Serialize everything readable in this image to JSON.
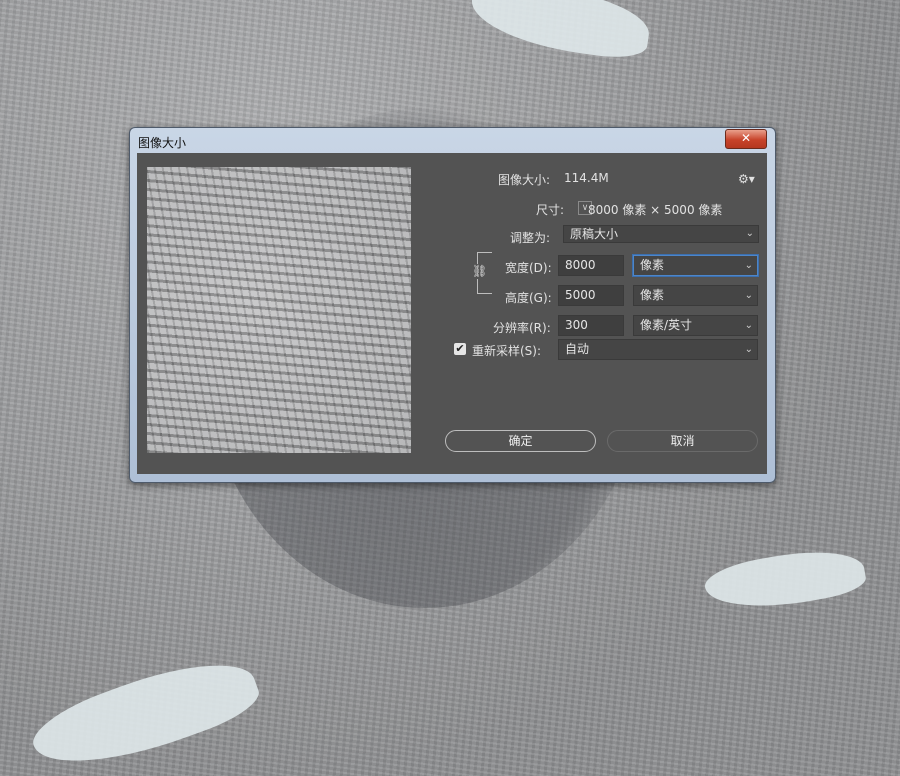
{
  "dialog": {
    "title": "图像大小",
    "close_symbol": "✕",
    "image_size_label": "图像大小:",
    "image_size_value": "114.4M",
    "settings_icon": "gear-icon",
    "dimensions_label": "尺寸:",
    "dimensions_value": "8000 像素 × 5000 像素",
    "fit_to_label": "调整为:",
    "fit_to_value": "原稿大小",
    "width_label": "宽度(D):",
    "width_value": "8000",
    "width_unit": "像素",
    "height_label": "高度(G):",
    "height_value": "5000",
    "height_unit": "像素",
    "resolution_label": "分辨率(R):",
    "resolution_value": "300",
    "resolution_unit": "像素/英寸",
    "resample_label": "重新采样(S):",
    "resample_checked": true,
    "resample_value": "自动",
    "ok_label": "确定",
    "cancel_label": "取消",
    "link_icon": "chain-link-icon"
  }
}
